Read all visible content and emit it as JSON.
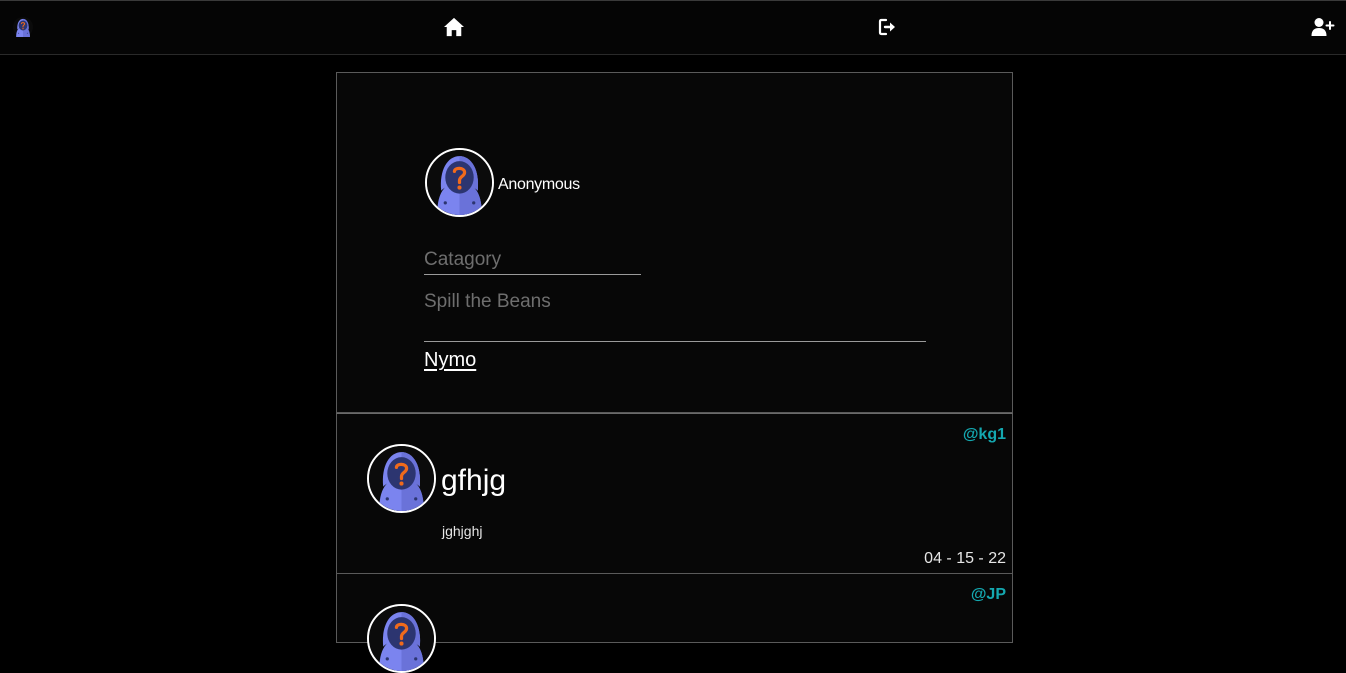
{
  "nav": {
    "logo_icon": "anonymous-hooded-avatar-icon",
    "home_icon": "home-icon",
    "logout_icon": "logout-icon",
    "signup_icon": "user-plus-icon"
  },
  "compose": {
    "username": "Anonymous",
    "category_placeholder": "Catagory",
    "body_placeholder": "Spill the Beans",
    "submit_label": "Nymo"
  },
  "posts": [
    {
      "handle": "@kg1",
      "title": "gfhjg",
      "body": "jghjghj",
      "date": "04 - 15 - 22"
    },
    {
      "handle": "@JP",
      "title": "",
      "body": "",
      "date": ""
    }
  ],
  "colors": {
    "background": "#000000",
    "handle_accent": "#14a8b0",
    "avatar_hood": "#7b84ef",
    "avatar_question": "#f06a1c"
  }
}
